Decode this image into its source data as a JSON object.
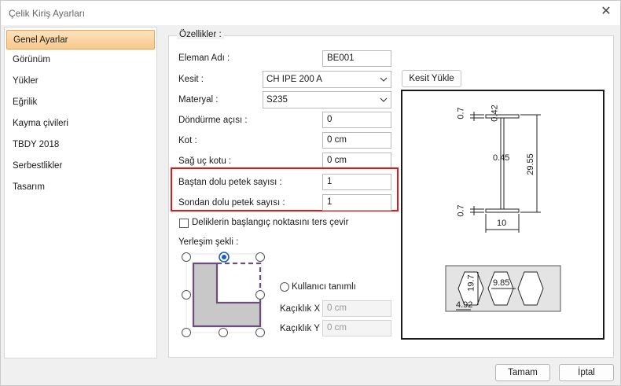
{
  "window": {
    "title": "Çelik Kiriş Ayarları"
  },
  "sidebar": {
    "items": [
      {
        "label": "Genel Ayarlar"
      },
      {
        "label": "Görünüm"
      },
      {
        "label": "Yükler"
      },
      {
        "label": "Eğrilik"
      },
      {
        "label": "Kayma çivileri"
      },
      {
        "label": "TBDY 2018"
      },
      {
        "label": "Serbestlikler"
      },
      {
        "label": "Tasarım"
      }
    ],
    "selected": "Genel Ayarlar"
  },
  "properties": {
    "group_title": "Özellikler :",
    "element_name": {
      "label": "Eleman Adı :",
      "value": "BE001"
    },
    "section": {
      "label": "Kesit :",
      "value": "CH IPE 200 A",
      "load_button": "Kesit Yükle"
    },
    "material": {
      "label": "Materyal :",
      "value": "S235"
    },
    "rotation": {
      "label": "Döndürme açısı :",
      "value": "0"
    },
    "elevation": {
      "label": "Kot :",
      "value": "0 cm"
    },
    "right_end_elevation": {
      "label": "Sağ uç kotu :",
      "value": "0 cm"
    },
    "start_full_cells": {
      "label": "Baştan dolu petek sayısı :",
      "value": "1"
    },
    "end_full_cells": {
      "label": "Sondan dolu petek sayısı :",
      "value": "1"
    },
    "reverse_holes": {
      "label": "Deliklerin başlangıç noktasını ters çevir",
      "checked": false
    },
    "placement": {
      "label": "Yerleşim şekli :",
      "selected_anchor": "top-center",
      "user_defined_label": "Kullanıcı tanımlı",
      "offset_x": {
        "label": "Kaçıklık X :",
        "value": "0 cm"
      },
      "offset_y": {
        "label": "Kaçıklık Y :",
        "value": "0 cm"
      }
    }
  },
  "section_drawing": {
    "dimensions": {
      "flange_thickness_top": "0.7",
      "flange_top_label": "0.42",
      "web_thickness": "0.45",
      "height": "29.55",
      "flange_thickness_bottom": "0.7",
      "flange_width": "10"
    },
    "cells": {
      "cell_height": "19.7",
      "cell_spacing": "9.85",
      "edge_offset": "4.92"
    }
  },
  "footer": {
    "ok": "Tamam",
    "cancel": "İptal"
  },
  "colors": {
    "accent": "#f7c98c",
    "highlight": "#e01818",
    "selected_radio": "#1e5fb8",
    "placement_shape": "#6b4f7a"
  }
}
